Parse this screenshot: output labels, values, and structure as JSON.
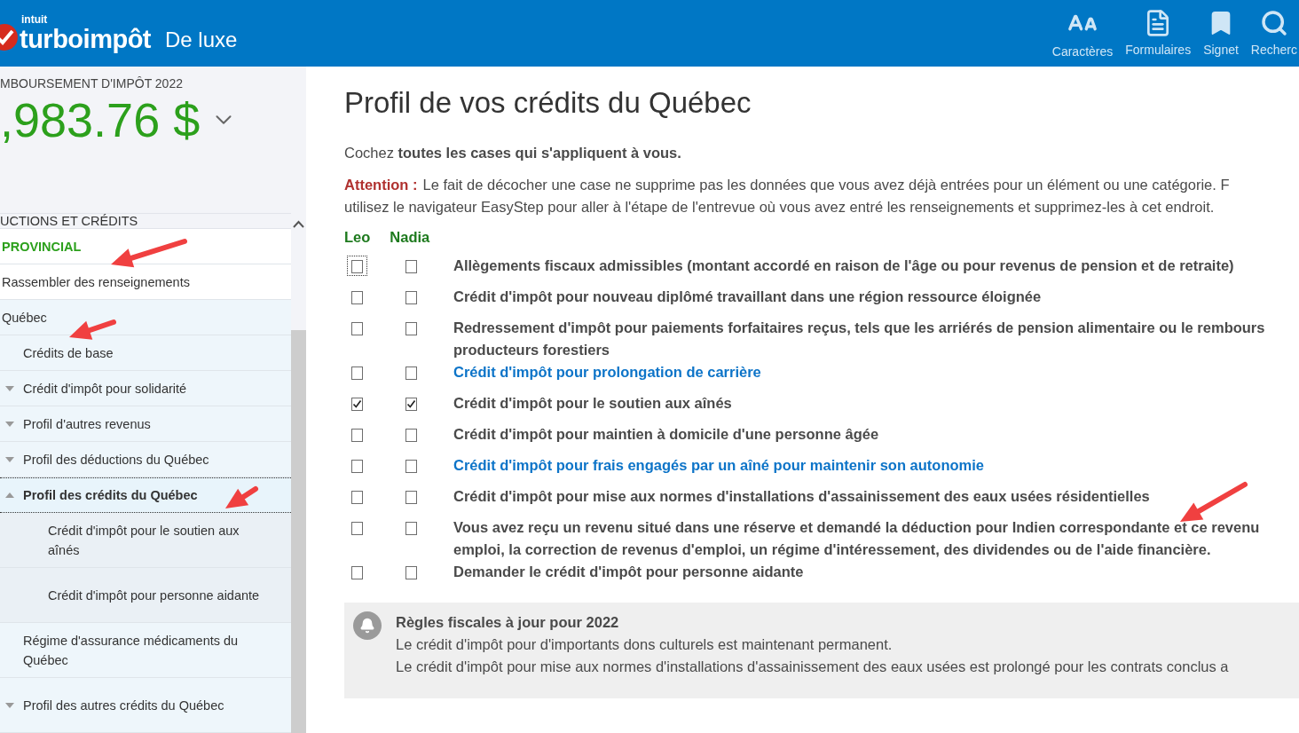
{
  "header": {
    "brand_small": "intuit",
    "brand": "turboimpôt",
    "edition": "De luxe",
    "tools": [
      {
        "kind": "font",
        "label": "Caractères"
      },
      {
        "kind": "forms",
        "label": "Formulaires"
      },
      {
        "kind": "bookmark",
        "label": "Signet"
      },
      {
        "kind": "search",
        "label": "Recherc"
      }
    ]
  },
  "sidebar": {
    "refund_label": "MBOURSEMENT D'IMPÔT 2022",
    "refund_amount": ",983.76 $",
    "section": "UCTIONS ET CRÉDITS",
    "items": [
      {
        "label": "PROVINCIAL",
        "kind": "heading",
        "selected": false
      },
      {
        "label": "Rassembler des renseignements",
        "kind": "plain",
        "selected": false
      },
      {
        "label": "Québec",
        "kind": "group",
        "selected": false,
        "children": [
          {
            "label": "Crédits de base",
            "selected": false
          },
          {
            "label": "Crédit d'impôt pour solidarité",
            "selected": false,
            "expanded": false
          },
          {
            "label": "Profil d'autres revenus",
            "selected": false,
            "expanded": false
          },
          {
            "label": "Profil des déductions du Québec",
            "selected": false,
            "expanded": false
          },
          {
            "label": "Profil des crédits du Québec",
            "selected": true,
            "expanded": true,
            "children": [
              {
                "label": "Crédit d'impôt pour le soutien aux aînés",
                "selected": false
              },
              {
                "label": "Crédit d'impôt pour personne aidante",
                "selected": false
              }
            ]
          },
          {
            "label": "Régime d'assurance médicaments du Québec",
            "selected": false
          },
          {
            "label": "Profil des autres crédits du Québec",
            "selected": false,
            "expanded": false
          }
        ]
      }
    ]
  },
  "page": {
    "title": "Profil de vos crédits du Québec",
    "intro": "Cochez **toutes les cases qui s'appliquent à vous.**",
    "warning": {
      "label": "Attention :",
      "lines": [
        "Le fait de décocher une case ne supprime pas les données que vous avez déjà entrées pour un élément ou une catégorie. F",
        "utilisez le navigateur EasyStep pour aller à l'étape de l'entrevue où vous avez entré les renseignements et supprimez-les à cet endroit."
      ]
    },
    "people": [
      "Leo",
      "Nadia"
    ],
    "rows": [
      {
        "kind": "text",
        "lines": [
          "Allègements fiscaux admissibles (montant accordé en raison de l'âge ou pour revenus de pension et de retraite)"
        ],
        "checks": [
          {
            "checked": false,
            "focused": true
          },
          {
            "checked": false,
            "focused": false
          }
        ]
      },
      {
        "kind": "text",
        "lines": [
          "Crédit d'impôt pour nouveau diplômé travaillant dans une région ressource éloignée"
        ],
        "checks": [
          {
            "checked": false,
            "focused": false
          },
          {
            "checked": false,
            "focused": false
          }
        ]
      },
      {
        "kind": "text",
        "lines": [
          "Redressement d'impôt pour paiements forfaitaires reçus, tels que les arriérés de pension alimentaire ou le rembours",
          "producteurs forestiers"
        ],
        "checks": [
          {
            "checked": false,
            "focused": false
          },
          {
            "checked": false,
            "focused": false
          }
        ]
      },
      {
        "kind": "link",
        "lines": [
          "Crédit d'impôt pour prolongation de carrière"
        ],
        "checks": [
          {
            "checked": false,
            "focused": false
          },
          {
            "checked": false,
            "focused": false
          }
        ]
      },
      {
        "kind": "text",
        "lines": [
          "Crédit d'impôt pour le soutien aux aînés"
        ],
        "checks": [
          {
            "checked": true,
            "focused": false
          },
          {
            "checked": true,
            "focused": false
          }
        ]
      },
      {
        "kind": "text",
        "lines": [
          "Crédit d'impôt pour maintien à domicile d'une personne âgée"
        ],
        "checks": [
          {
            "checked": false,
            "focused": false
          },
          {
            "checked": false,
            "focused": false
          }
        ]
      },
      {
        "kind": "link",
        "lines": [
          "Crédit d'impôt pour frais engagés par un aîné pour maintenir son autonomie"
        ],
        "checks": [
          {
            "checked": false,
            "focused": false
          },
          {
            "checked": false,
            "focused": false
          }
        ]
      },
      {
        "kind": "text",
        "lines": [
          "Crédit d'impôt pour mise aux normes d'installations d'assainissement des eaux usées résidentielles"
        ],
        "checks": [
          {
            "checked": false,
            "focused": false
          },
          {
            "checked": false,
            "focused": false
          }
        ]
      },
      {
        "kind": "text",
        "lines": [
          "Vous avez reçu un revenu situé dans une réserve et demandé la déduction pour Indien correspondante et ce revenu",
          "emploi, la correction de revenus d'emploi, un régime d'intéressement, des dividendes ou de l'aide financière."
        ],
        "checks": [
          {
            "checked": false,
            "focused": false
          },
          {
            "checked": false,
            "focused": false
          }
        ]
      },
      {
        "kind": "text",
        "lines": [
          "Demander le crédit d'impôt pour personne aidante"
        ],
        "checks": [
          {
            "checked": false,
            "focused": false
          },
          {
            "checked": false,
            "focused": false
          }
        ]
      }
    ],
    "notice": {
      "title": "Règles fiscales à jour pour 2022",
      "lines": [
        "Le crédit d'impôt pour d'importants dons culturels est maintenant permanent.",
        "Le crédit d'impôt pour mise aux normes d'installations d'assainissement des eaux usées est prolongé pour les contrats conclus a"
      ]
    }
  }
}
